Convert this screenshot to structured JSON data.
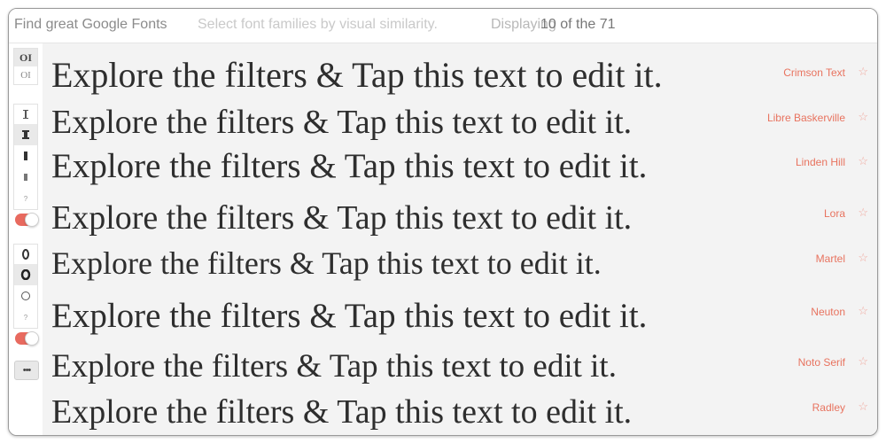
{
  "header": {
    "title": "Find great Google Fonts",
    "hint": "Select font families by visual similarity.",
    "displaying_label": "Displaying",
    "count_text": "10 of the 71"
  },
  "sidebar": {
    "contrast_group": {
      "option_high": "OI",
      "option_low": "OI"
    },
    "weight_group": {
      "unknown_label": "?"
    },
    "width_group": {
      "unknown_label": "?"
    },
    "toggle_1_on": true,
    "toggle_2_on": true,
    "more_label": "•••"
  },
  "sample_text": "Explore the filters & Tap this text to edit it.",
  "fonts": [
    {
      "name": "Crimson Text",
      "star": "☆"
    },
    {
      "name": "Libre Baskerville",
      "star": "☆"
    },
    {
      "name": "Linden Hill",
      "star": "☆"
    },
    {
      "name": "Lora",
      "star": "☆"
    },
    {
      "name": "Martel",
      "star": "☆"
    },
    {
      "name": "Neuton",
      "star": "☆"
    },
    {
      "name": "Noto Serif",
      "star": "☆"
    },
    {
      "name": "Radley",
      "star": "☆"
    }
  ],
  "colors": {
    "accent": "#e8735f",
    "toggle": "#e86a5f",
    "main_bg": "#f3f3f3"
  }
}
